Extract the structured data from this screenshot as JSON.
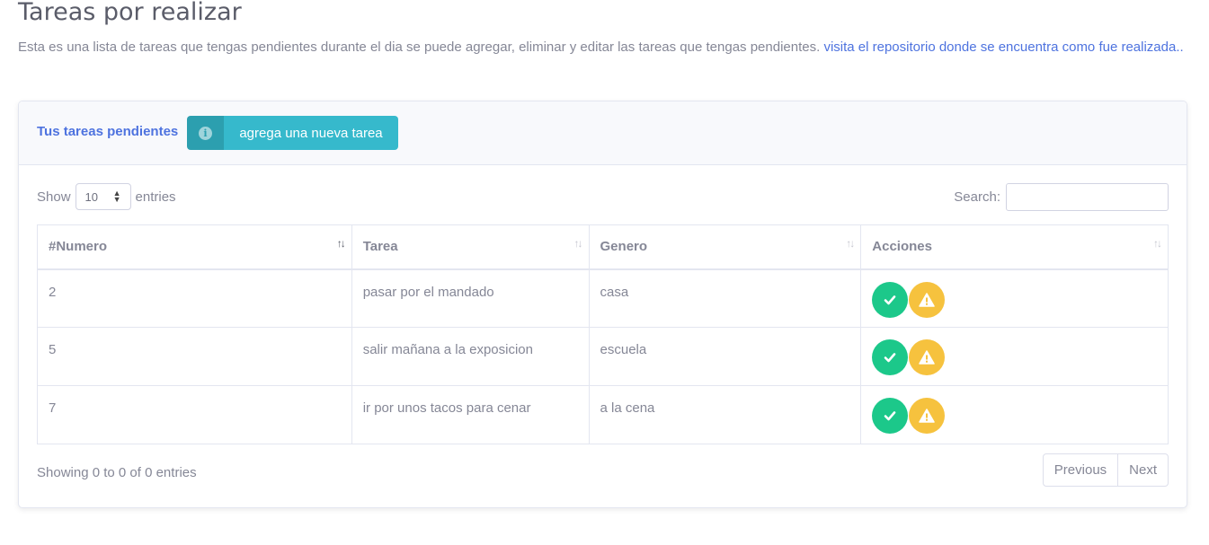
{
  "page": {
    "title": "Tareas por realizar",
    "intro_text": "Esta es una lista de tareas que tengas pendientes durante el dia se puede agregar, eliminar y editar las tareas que tengas pendientes. ",
    "intro_link": "visita el repositorio donde se encuentra como fue realizada.."
  },
  "card": {
    "header_title": "Tus tareas pendientes",
    "new_task_button": "agrega una nueva tarea",
    "info_icon": "info-circle-icon"
  },
  "table_controls": {
    "show_label": "Show",
    "entries_value": "10",
    "entries_label": "entries",
    "search_label": "Search:",
    "search_value": ""
  },
  "table": {
    "columns": [
      "#Numero",
      "Tarea",
      "Genero",
      "Acciones"
    ],
    "rows": [
      {
        "numero": "2",
        "tarea": "pasar por el mandado",
        "genero": "casa"
      },
      {
        "numero": "5",
        "tarea": "salir mañana a la exposicion",
        "genero": "escuela"
      },
      {
        "numero": "7",
        "tarea": "ir por unos tacos para cenar",
        "genero": "a la cena"
      }
    ],
    "actions": {
      "complete_icon": "check-icon",
      "warning_icon": "warning-icon"
    }
  },
  "footer": {
    "info": "Showing 0 to 0 of 0 entries",
    "previous": "Previous",
    "next": "Next"
  },
  "colors": {
    "primary": "#4e73df",
    "info": "#36b9cc",
    "success": "#1cc88a",
    "warning": "#f6c23e",
    "text": "#858796"
  }
}
